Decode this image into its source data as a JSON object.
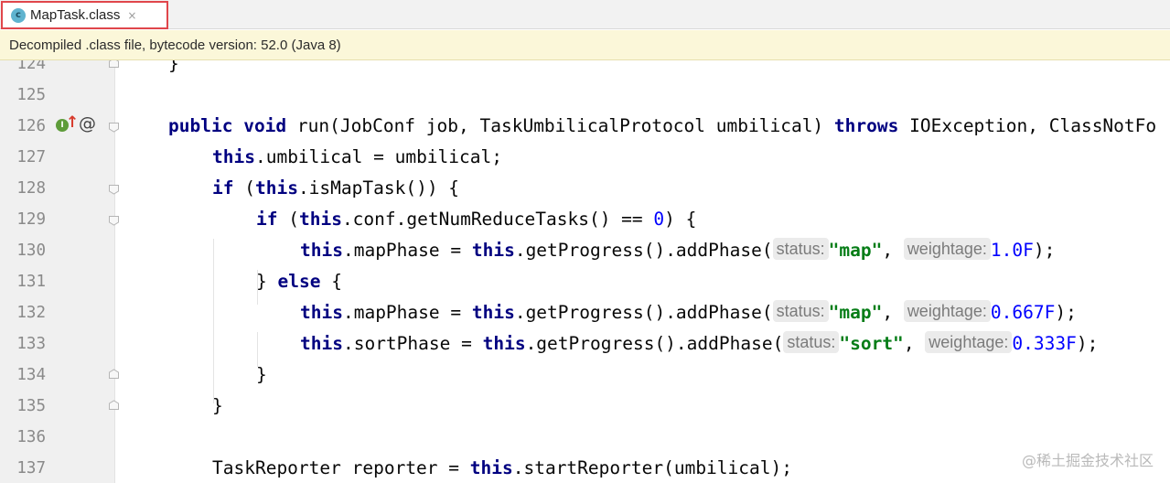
{
  "tab": {
    "icon_letter": "c",
    "label": "MapTask.class",
    "close_glyph": "×"
  },
  "banner": {
    "text": "Decompiled .class file, bytecode version: 52.0 (Java 8)"
  },
  "editor": {
    "line_numbers": [
      "124",
      "125",
      "126",
      "127",
      "128",
      "129",
      "130",
      "131",
      "132",
      "133",
      "134",
      "135",
      "136",
      "137"
    ],
    "code": {
      "l124": {
        "brace": "}"
      },
      "l126": {
        "kw1": "public",
        "kw2": "void",
        "sig": " run(JobConf job, TaskUmbilicalProtocol umbilical) ",
        "kw3": "throws",
        "rest": " IOException, ClassNotFo"
      },
      "l127": {
        "kw": "this",
        "rest": ".umbilical = umbilical;"
      },
      "l128": {
        "kw1": "if",
        "mid": " (",
        "kw2": "this",
        "rest": ".isMapTask()) {"
      },
      "l129": {
        "kw1": "if",
        "mid": " (",
        "kw2": "this",
        "mid2": ".conf.getNumReduceTasks() == ",
        "num": "0",
        "rest": ") {"
      },
      "l130": {
        "kw1": "this",
        "mid": ".mapPhase = ",
        "kw2": "this",
        "mid2": ".getProgress().addPhase(",
        "hint1": "status:",
        "str": "\"map\"",
        "sep": ", ",
        "hint2": "weightage:",
        "num": "1.0F",
        "end": ");"
      },
      "l131": {
        "pre": "} ",
        "kw": "else",
        "rest": " {"
      },
      "l132": {
        "kw1": "this",
        "mid": ".mapPhase = ",
        "kw2": "this",
        "mid2": ".getProgress().addPhase(",
        "hint1": "status:",
        "str": "\"map\"",
        "sep": ", ",
        "hint2": "weightage:",
        "num": "0.667F",
        "end": ");"
      },
      "l133": {
        "kw1": "this",
        "mid": ".sortPhase = ",
        "kw2": "this",
        "mid2": ".getProgress().addPhase(",
        "hint1": "status:",
        "str": "\"sort\"",
        "sep": ", ",
        "hint2": "weightage:",
        "num": "0.333F",
        "end": ");"
      },
      "l134": {
        "brace": "}"
      },
      "l135": {
        "brace": "}"
      },
      "l137": {
        "pre": "TaskReporter reporter = ",
        "kw": "this",
        "rest": ".startReporter(umbilical);"
      }
    },
    "gutter_icons": {
      "implements": "I",
      "arrow": "↑",
      "annotation": "@"
    }
  },
  "watermark": "@稀土掘金技术社区",
  "colors": {
    "keyword": "#000080",
    "number": "#0000ff",
    "string": "#067d17",
    "hint_bg": "#ebebeb",
    "banner_bg": "#fbf7d9",
    "tab_border": "#e0464b"
  }
}
